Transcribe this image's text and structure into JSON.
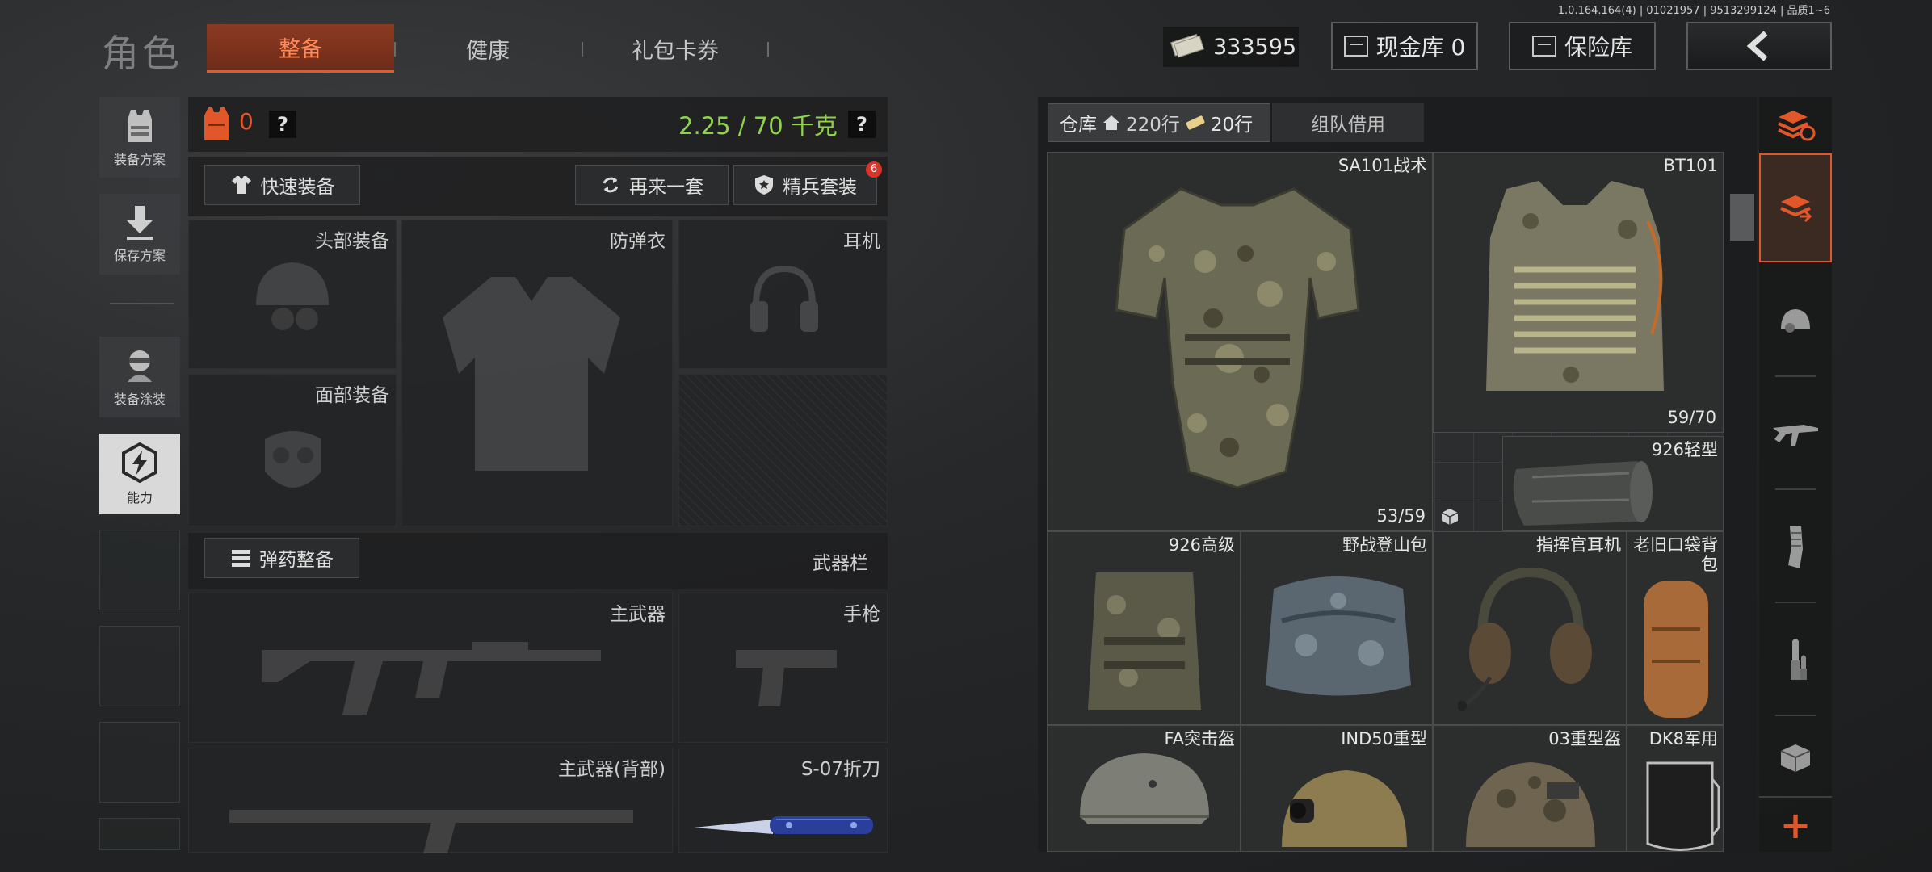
{
  "version": "1.0.164.164(4) | 01021957 | 9513299124 | 品质1~6",
  "header": {
    "title": "角色",
    "tabs": [
      {
        "label": "整备",
        "active": true
      },
      {
        "label": "健康",
        "active": false
      },
      {
        "label": "礼包卡券",
        "active": false
      }
    ],
    "currency_amount": "333595",
    "cash_vault_label": "现金库 0",
    "safe_vault_label": "保险库"
  },
  "sidebar": {
    "items": [
      {
        "label": "装备方案",
        "icon": "vest-plan-icon"
      },
      {
        "label": "保存方案",
        "icon": "download-icon"
      },
      {
        "label": "装备涂装",
        "icon": "skin-icon"
      },
      {
        "label": "能力",
        "icon": "lightning-hex-icon",
        "active": true
      }
    ]
  },
  "loadout": {
    "armor_count": "0",
    "help_label": "?",
    "weight": "2.25 / 70 千克",
    "quick_equip_label": "快速装备",
    "another_set_label": "再来一套",
    "elite_set_label": "精兵套装",
    "elite_badge": "6",
    "slots": {
      "head": "头部装备",
      "vest": "防弹衣",
      "headset": "耳机",
      "face": "面部装备"
    },
    "ammo_label": "弹药整备",
    "weapon_bar_label": "武器栏",
    "weapons": {
      "primary": "主武器",
      "pistol": "手枪",
      "primary_back": "主武器(背部)",
      "knife": "S-07折刀"
    }
  },
  "storage": {
    "tab_label": "仓库",
    "rows_label": "220行",
    "extra_rows_label": "20行",
    "team_borrow_label": "组队借用",
    "items": [
      {
        "name": "SA101战术",
        "durability": "53/59"
      },
      {
        "name": "BT101",
        "durability": "59/70"
      },
      {
        "name": "926轻型",
        "durability": ""
      },
      {
        "name": "926高级",
        "durability": ""
      },
      {
        "name": "野战登山包",
        "durability": ""
      },
      {
        "name": "指挥官耳机",
        "durability": ""
      },
      {
        "name": "老旧口袋背包",
        "durability": ""
      },
      {
        "name": "FA突击盔",
        "durability": ""
      },
      {
        "name": "IND50重型",
        "durability": ""
      },
      {
        "name": "03重型盔",
        "durability": ""
      },
      {
        "name": "DK8军用",
        "durability": ""
      }
    ]
  },
  "filter_strip": {
    "icons": [
      "sort-icon",
      "armor-filter-icon",
      "helmet-filter-icon",
      "rifle-filter-icon",
      "magazine-filter-icon",
      "ammo-filter-icon",
      "container-filter-icon"
    ],
    "add_label": "+"
  },
  "colors": {
    "accent": "#e2572a",
    "weight_text": "#8fd34a",
    "armor_icon": "#e2572a"
  }
}
